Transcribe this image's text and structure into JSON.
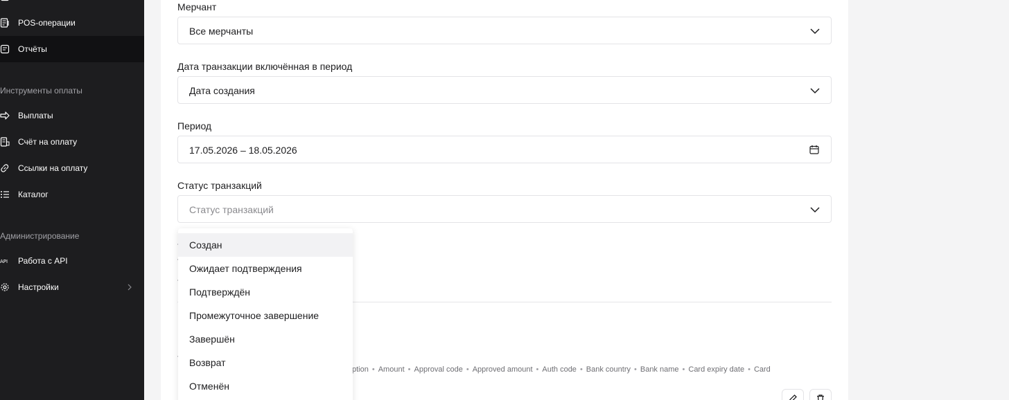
{
  "sidebar": {
    "items_top": [
      {
        "label": "POS-операции",
        "icon": "pos-icon"
      },
      {
        "label": "Отчёты",
        "icon": "report-icon",
        "active": true
      }
    ],
    "section_payment_tools": "Инструменты оплаты",
    "payment_items": [
      {
        "label": "Выплаты",
        "icon": "arrow-right-icon"
      },
      {
        "label": "Счёт на оплату",
        "icon": "invoice-icon"
      },
      {
        "label": "Ссылки на оплату",
        "icon": "link-icon"
      },
      {
        "label": "Каталог",
        "icon": "list-icon"
      }
    ],
    "section_admin": "Администрирование",
    "admin_items": [
      {
        "label": "Работа с API",
        "icon": "api-icon"
      },
      {
        "label": "Настройки",
        "icon": "gear-icon"
      }
    ]
  },
  "form": {
    "merchant": {
      "label": "Мерчант",
      "value": "Все мерчанты"
    },
    "date_type": {
      "label": "Дата транзакции включённая в период",
      "value": "Дата создания"
    },
    "period": {
      "label": "Период",
      "value": "17.05.2026 – 18.05.2026"
    },
    "status": {
      "label": "Статус транзакций",
      "placeholder": "Статус транзакций"
    }
  },
  "status_options": [
    "Создан",
    "Ожидает подтверждения",
    "Подтверждён",
    "Промежуточное завершение",
    "Завершён",
    "Возврат",
    "Отменён"
  ],
  "columns": {
    "partial_first": "ption",
    "items": [
      "Amount",
      "Approval code",
      "Approved amount",
      "Auth code",
      "Bank country",
      "Bank name",
      "Card expiry date"
    ],
    "truncated_last": "Card n...",
    "separator": "•"
  },
  "colors": {
    "sidebar_bg": "#1d1d1f",
    "active_bg": "#111113",
    "card_bg": "#ffffff",
    "border": "#e3e3e6",
    "hover": "#f2f2f4"
  }
}
